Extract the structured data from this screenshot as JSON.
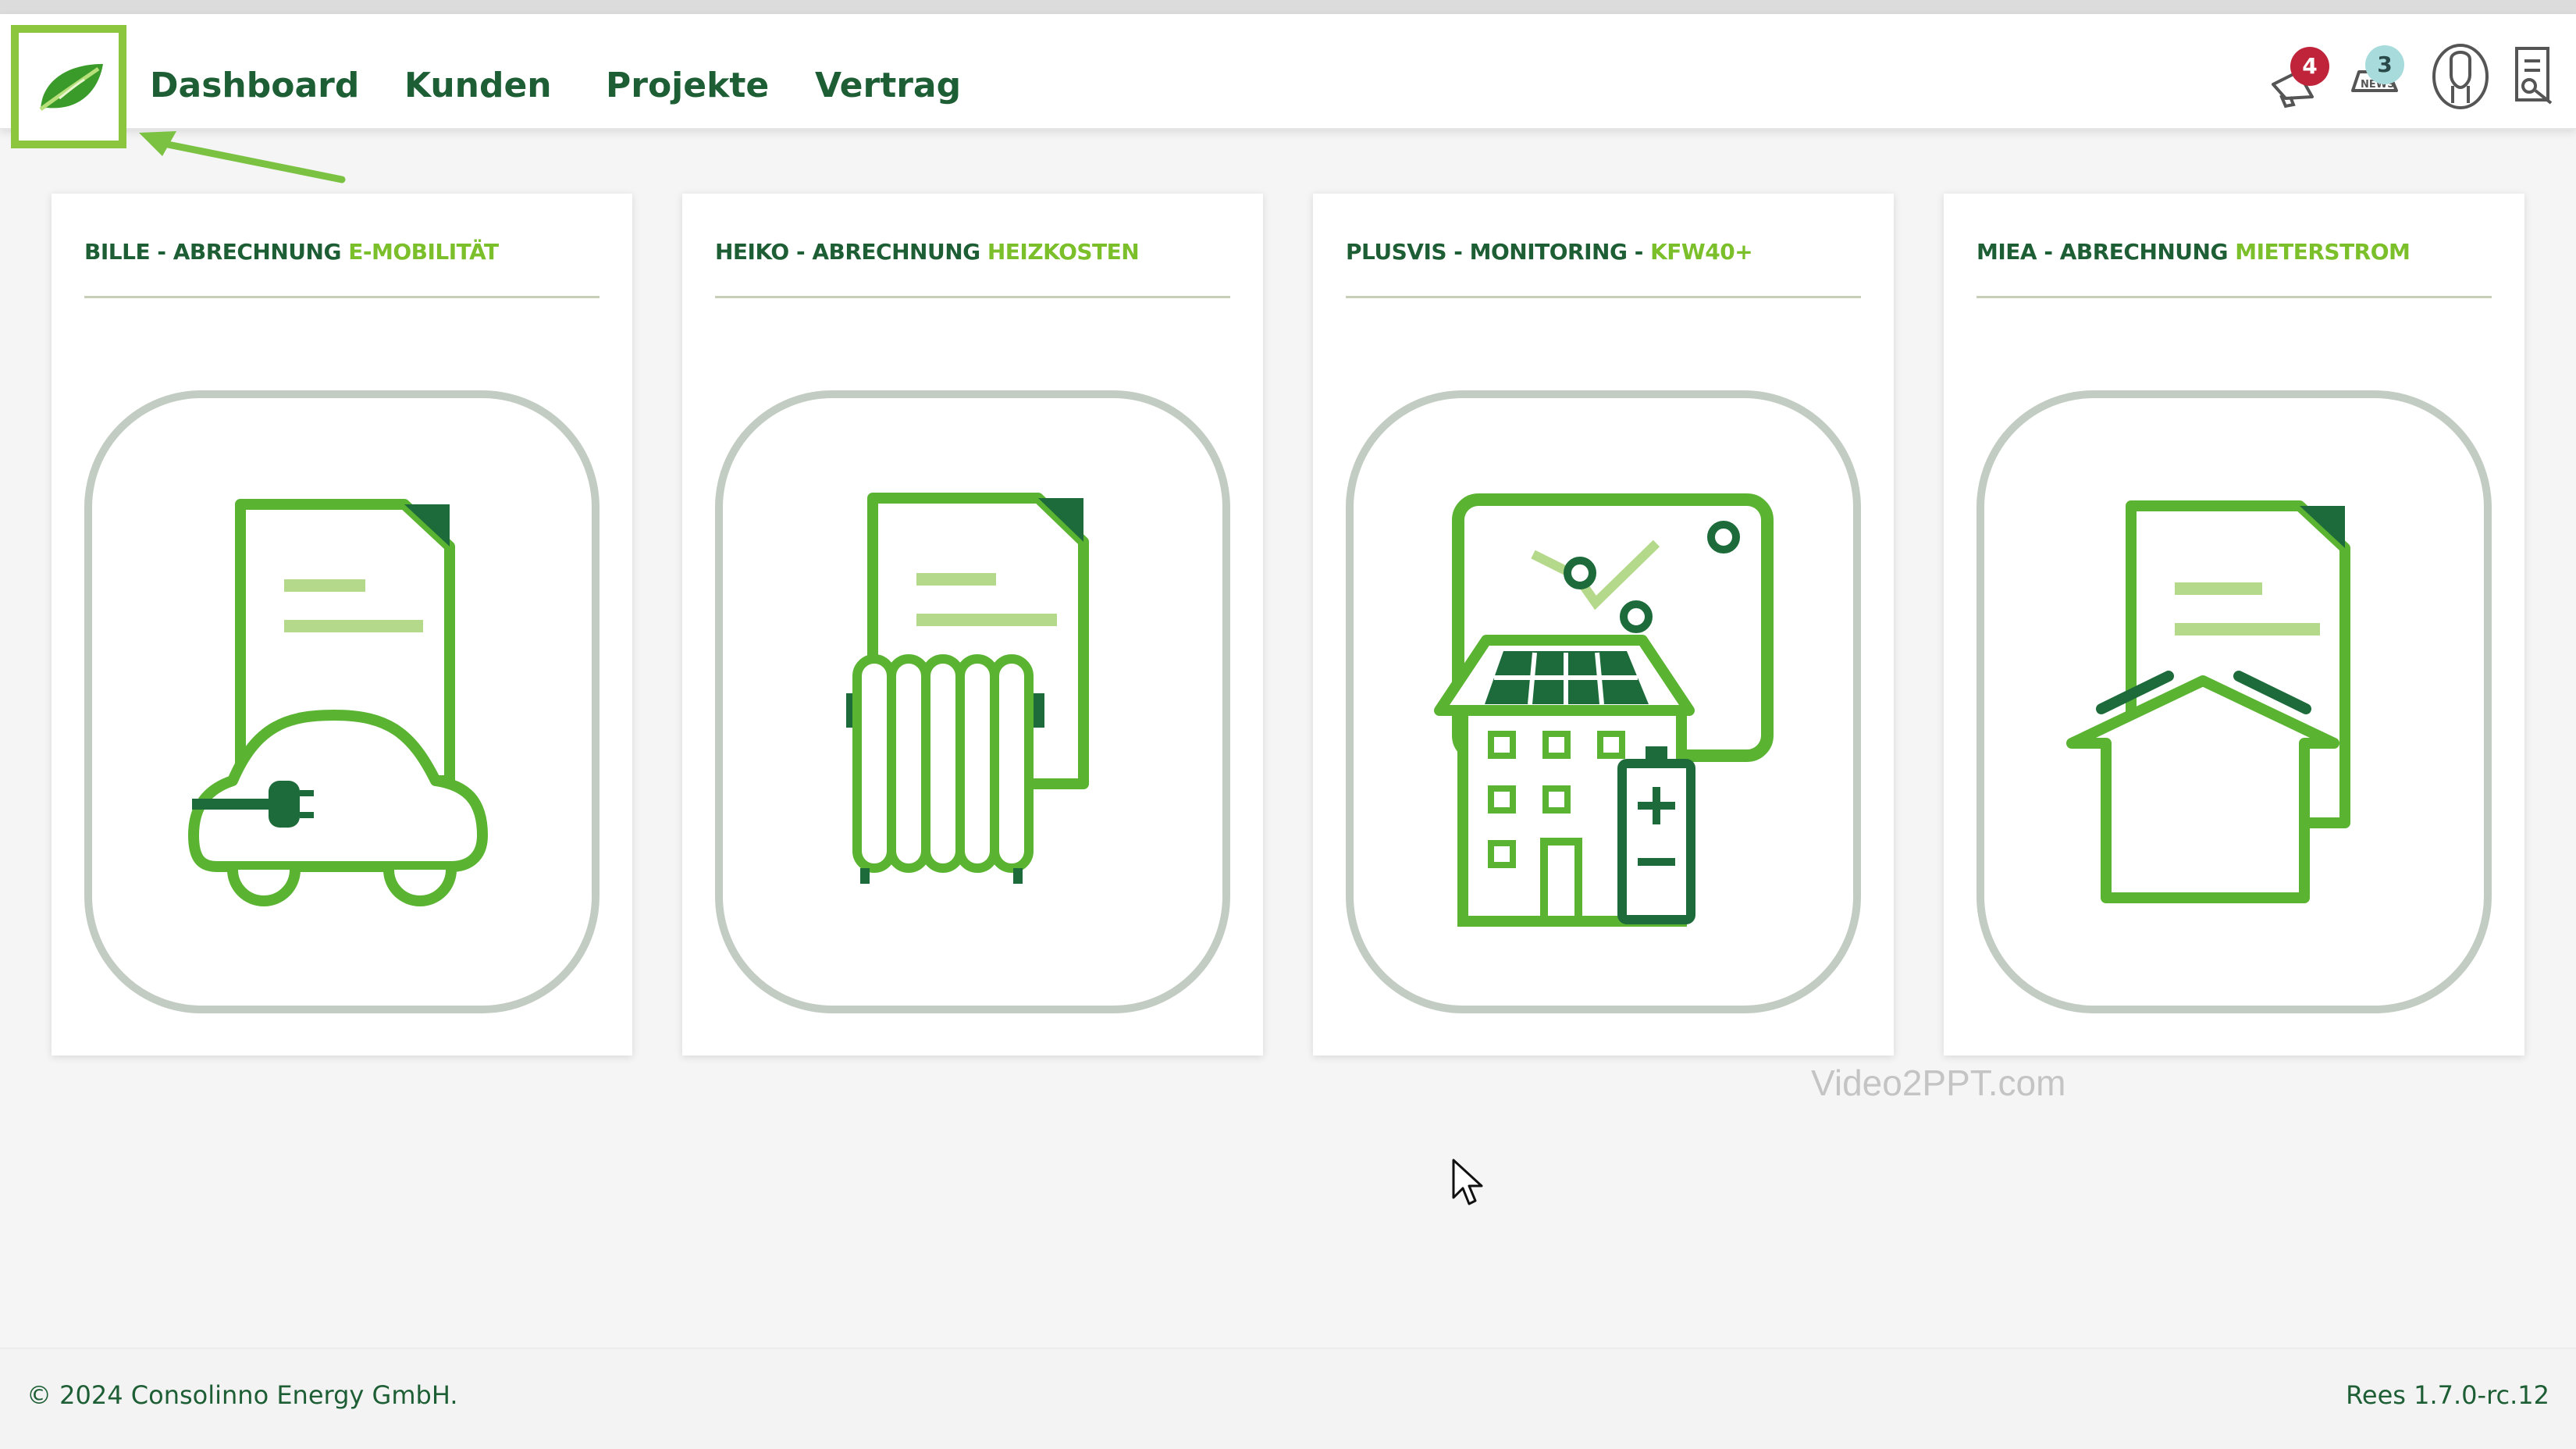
{
  "nav": {
    "links": [
      "Dashboard",
      "Kunden",
      "Projekte",
      "Vertrag"
    ],
    "notifications_count": "4",
    "messages_count": "3",
    "icons": [
      "leaf-logo-icon",
      "megaphone-icon",
      "news-icon",
      "user-icon",
      "document-icon"
    ]
  },
  "cards": [
    {
      "prefix": "BILLE - ABRECHNUNG ",
      "highlight": "E-MOBILITÄT",
      "icon": "ev-billing-icon"
    },
    {
      "prefix": "HEIKO - ABRECHNUNG ",
      "highlight": "HEIZKOSTEN",
      "icon": "heating-billing-icon"
    },
    {
      "prefix": "PLUSVIS - MONITORING - ",
      "highlight": "KFW40+",
      "icon": "building-monitoring-icon"
    },
    {
      "prefix": "MIEA - ABRECHNUNG ",
      "highlight": "MIETERSTROM",
      "icon": "tenant-power-icon"
    }
  ],
  "watermark": "Video2PPT.com",
  "footer": {
    "copyright": "© 2024 Consolinno Energy GmbH.",
    "version": "Rees 1.7.0-rc.12"
  },
  "colors": {
    "dark_green": "#1d5e35",
    "accent_green": "#7bbf2a",
    "icon_green": "#5ab432",
    "highlight_box": "#8cc63f",
    "badge_red": "#c0243a"
  }
}
